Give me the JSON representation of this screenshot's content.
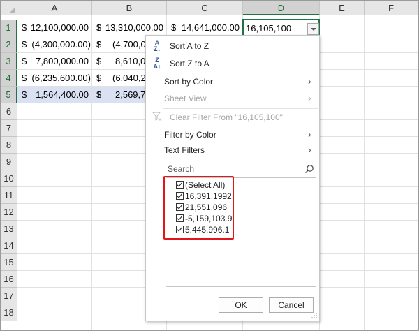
{
  "columns": [
    "A",
    "B",
    "C",
    "D",
    "E",
    "F"
  ],
  "rows": [
    "1",
    "2",
    "3",
    "4",
    "5",
    "6",
    "7",
    "8",
    "9",
    "10",
    "11",
    "12",
    "13",
    "14",
    "15",
    "16",
    "17",
    "18"
  ],
  "cells": {
    "A1": {
      "sym": "$",
      "val": "12,100,000.00"
    },
    "B1": {
      "sym": "$",
      "val": "13,310,000.00"
    },
    "C1": {
      "sym": "$",
      "val": "14,641,000.00"
    },
    "D1": {
      "val": "16,105,100"
    },
    "A2": {
      "sym": "$",
      "val": "(4,300,000.00)"
    },
    "B2": {
      "sym": "$",
      "val": "(4,700,00"
    },
    "A3": {
      "sym": "$",
      "val": "7,800,000.00"
    },
    "B3": {
      "sym": "$",
      "val": "8,610,00"
    },
    "A4": {
      "sym": "$",
      "val": "(6,235,600.00)"
    },
    "B4": {
      "sym": "$",
      "val": "(6,040,28"
    },
    "A5": {
      "sym": "$",
      "val": "1,564,400.00"
    },
    "B5": {
      "sym": "$",
      "val": "2,569,71"
    }
  },
  "menu": {
    "sort_az": "Sort A to Z",
    "sort_za": "Sort Z to A",
    "sort_by_color": "Sort by Color",
    "sheet_view": "Sheet View",
    "clear_filter": "Clear Filter From \"16,105,100\"",
    "filter_by_color": "Filter by Color",
    "text_filters": "Text Filters",
    "search_placeholder": "Search",
    "list_items": [
      "(Select All)",
      "16,391,1992",
      "21,551,096",
      "-5,159,103.9",
      "5,445,996.1"
    ],
    "ok_label": "OK",
    "cancel_label": "Cancel"
  },
  "colors": {
    "selection_green": "#217346",
    "highlight_row": "#d9e1f2",
    "annotation_red": "#e0161c"
  }
}
